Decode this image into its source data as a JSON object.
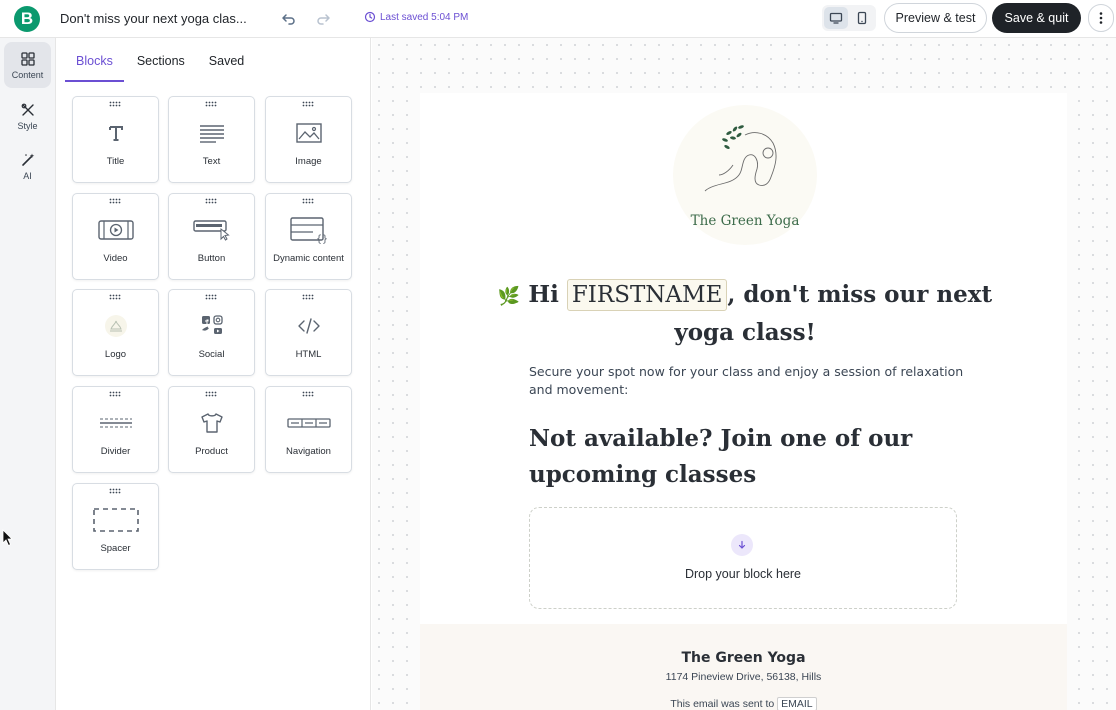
{
  "topbar": {
    "logo_letter": "B",
    "doc_title": "Don't miss your next yoga clas...",
    "last_saved": "Last saved 5:04 PM",
    "preview_label": "Preview & test",
    "save_label": "Save & quit"
  },
  "rail": {
    "items": [
      {
        "label": "Content",
        "icon": "grid-icon",
        "active": true
      },
      {
        "label": "Style",
        "icon": "brush-icon",
        "active": false
      },
      {
        "label": "AI",
        "icon": "magic-wand-icon",
        "active": false
      }
    ]
  },
  "panel": {
    "tabs": [
      {
        "label": "Blocks",
        "active": true
      },
      {
        "label": "Sections",
        "active": false
      },
      {
        "label": "Saved",
        "active": false
      }
    ],
    "blocks": [
      {
        "label": "Title",
        "icon": "title-icon"
      },
      {
        "label": "Text",
        "icon": "text-icon"
      },
      {
        "label": "Image",
        "icon": "image-icon"
      },
      {
        "label": "Video",
        "icon": "video-icon"
      },
      {
        "label": "Button",
        "icon": "button-icon"
      },
      {
        "label": "Dynamic content",
        "icon": "dynamic-content-icon"
      },
      {
        "label": "Logo",
        "icon": "logo-icon"
      },
      {
        "label": "Social",
        "icon": "social-icon"
      },
      {
        "label": "HTML",
        "icon": "html-icon"
      },
      {
        "label": "Divider",
        "icon": "divider-icon"
      },
      {
        "label": "Product",
        "icon": "product-icon"
      },
      {
        "label": "Navigation",
        "icon": "navigation-icon"
      },
      {
        "label": "Spacer",
        "icon": "spacer-icon"
      }
    ]
  },
  "email": {
    "brand_name": "The Green Yoga",
    "greeting_pre": "Hi ",
    "firstname_tag": "FIRSTNAME",
    "greeting_post": ", don't miss our next yoga class!",
    "intro": "Secure your spot now for your class and enjoy a session of relaxation and movement:",
    "heading2": "Not available? Join one of our upcoming classes",
    "drop_text": "Drop your block here",
    "footer": {
      "name": "The Green Yoga",
      "address": "1174 Pineview Drive, 56138, Hills",
      "sent_to_prefix": "This email was sent to",
      "email_tag": "EMAIL"
    }
  },
  "colors": {
    "brand_green": "#0b996e",
    "accent_purple": "#6b4fd3",
    "dark_button": "#1f2328"
  }
}
